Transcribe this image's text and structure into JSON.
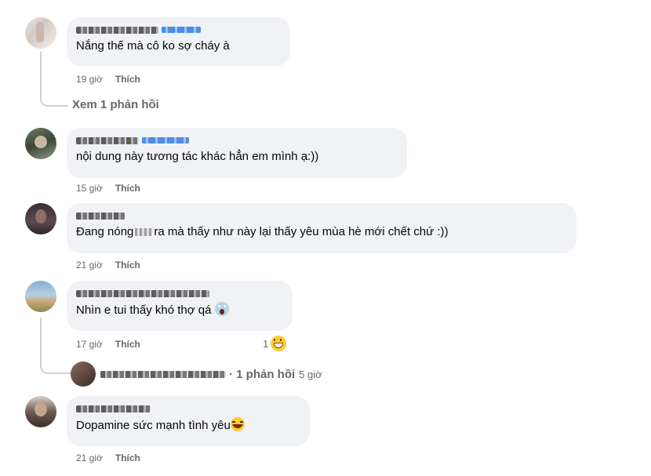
{
  "comments": [
    {
      "text": "Nắng thế mà cô ko sợ cháy à",
      "time": "19 giờ",
      "like": "Thích",
      "view_replies": "Xem 1 phản hồi"
    },
    {
      "text": "nội dung này tương tác khác hẳn em mình ạ:))",
      "time": "15 giờ",
      "like": "Thích"
    },
    {
      "text_before": "Đang nóng",
      "text_after": "ra mà thấy như này lại thấy yêu mùa hè mới chết chứ :))",
      "time": "21 giờ",
      "like": "Thích"
    },
    {
      "text": "Nhìn e tui thấy khó thợ qá",
      "time": "17 giờ",
      "like": "Thích",
      "reaction_count": "1",
      "reply_summary": "· 1 phản hồi",
      "reply_time": "5 giờ"
    },
    {
      "text": "Dopamine sức mạnh tình yêu",
      "time": "21 giờ",
      "like": "Thích"
    }
  ],
  "icons": [
    "avatar",
    "face-screaming-emoji",
    "grinning-emoji",
    "laughing-emoji"
  ],
  "colors": {
    "bubble": "#f0f2f5",
    "meta": "#65676b",
    "link_blue": "#1877f2"
  }
}
